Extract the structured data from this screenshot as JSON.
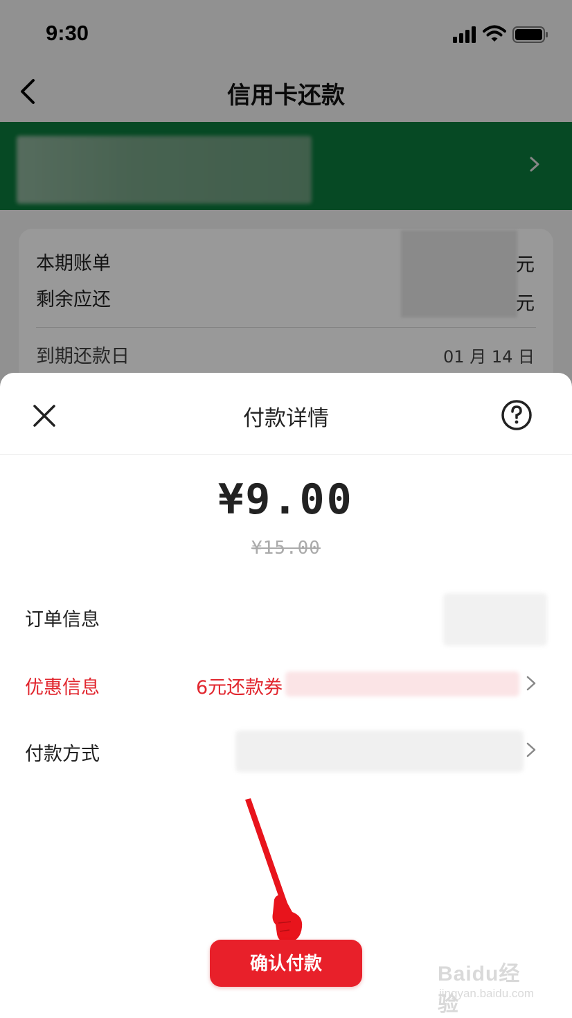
{
  "status_bar": {
    "time": "9:30"
  },
  "nav": {
    "title": "信用卡还款"
  },
  "bill": {
    "current_label": "本期账单",
    "current_unit": "元",
    "remaining_label": "剩余应还",
    "remaining_unit": "元",
    "due_label": "到期还款日",
    "due_value": "01 月 14 日"
  },
  "sheet": {
    "title": "付款详情",
    "amount": "¥9.00",
    "original_amount": "¥15.00",
    "order_label": "订单信息",
    "discount_label": "优惠信息",
    "discount_value": "6元还款券",
    "payment_method_label": "付款方式",
    "confirm_label": "确认付款"
  },
  "watermark": {
    "main": "Baidu经验",
    "sub": "jingyan.baidu.com"
  },
  "colors": {
    "brand_green": "#0a7a3c",
    "accent_red": "#e1262e",
    "button_red": "#e8202a"
  },
  "icons": [
    "back-icon",
    "chevron-right-icon",
    "close-icon",
    "help-icon",
    "signal-icon",
    "wifi-icon",
    "battery-icon",
    "pointer-arrow-icon"
  ]
}
